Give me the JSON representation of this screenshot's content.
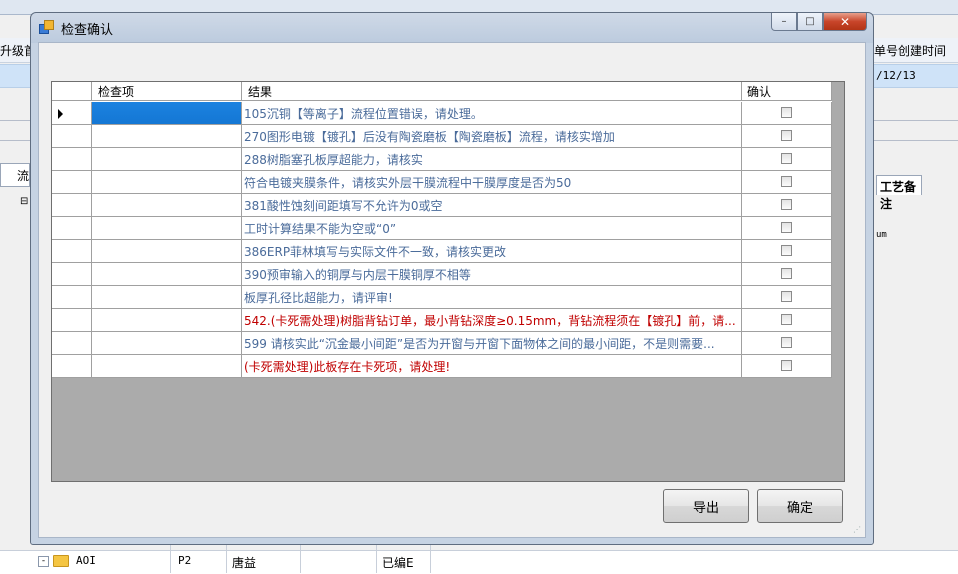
{
  "background": {
    "left_text": "升级首",
    "right_header": "单号创建时间",
    "right_date": "/12/13",
    "tab_label": "工艺备注",
    "right_panel_text": "um",
    "left_panel_text": "流",
    "bottom_row": {
      "name": "AOI",
      "code": "P2",
      "person": "唐益",
      "status": "已编E"
    }
  },
  "dialog": {
    "title": "检查确认",
    "window_buttons": {
      "minimize": "–",
      "maximize": "□",
      "close": "✕"
    },
    "grid": {
      "columns": [
        "检查项",
        "结果",
        "确认"
      ],
      "rows": [
        {
          "item": "",
          "result": "105沉铜【等离子】流程位置错误，请处理。",
          "red": false,
          "selected": true,
          "current": true
        },
        {
          "item": "",
          "result": "270图形电镀【镀孔】后没有陶瓷磨板【陶瓷磨板】流程，请核实增加",
          "red": false
        },
        {
          "item": "",
          "result": "288树脂塞孔板厚超能力，请核实",
          "red": false
        },
        {
          "item": "",
          "result": "符合电镀夹膜条件，请核实外层干膜流程中干膜厚度是否为50",
          "red": false
        },
        {
          "item": "",
          "result": "381酸性蚀刻间距填写不允许为0或空",
          "red": false
        },
        {
          "item": "",
          "result": "工时计算结果不能为空或“0”",
          "red": false
        },
        {
          "item": "",
          "result": "386ERP菲林填写与实际文件不一致，请核实更改",
          "red": false
        },
        {
          "item": "",
          "result": "390预审输入的铜厚与内层干膜铜厚不相等",
          "red": false
        },
        {
          "item": "",
          "result": "板厚孔径比超能力，请评审!",
          "red": false
        },
        {
          "item": "",
          "result": "542.(卡死需处理)树脂背钻订单，最小背钻深度≥0.15mm，背钻流程须在【镀孔】前，请...",
          "red": true
        },
        {
          "item": "",
          "result": "599 请核实此“沉金最小间距”是否为开窗与开窗下面物体之间的最小间距，不是则需要...",
          "red": false
        },
        {
          "item": "",
          "result": "(卡死需处理)此板存在卡死项，请处理!",
          "red": true
        }
      ]
    },
    "buttons": {
      "export": "导出",
      "confirm": "确定"
    }
  }
}
